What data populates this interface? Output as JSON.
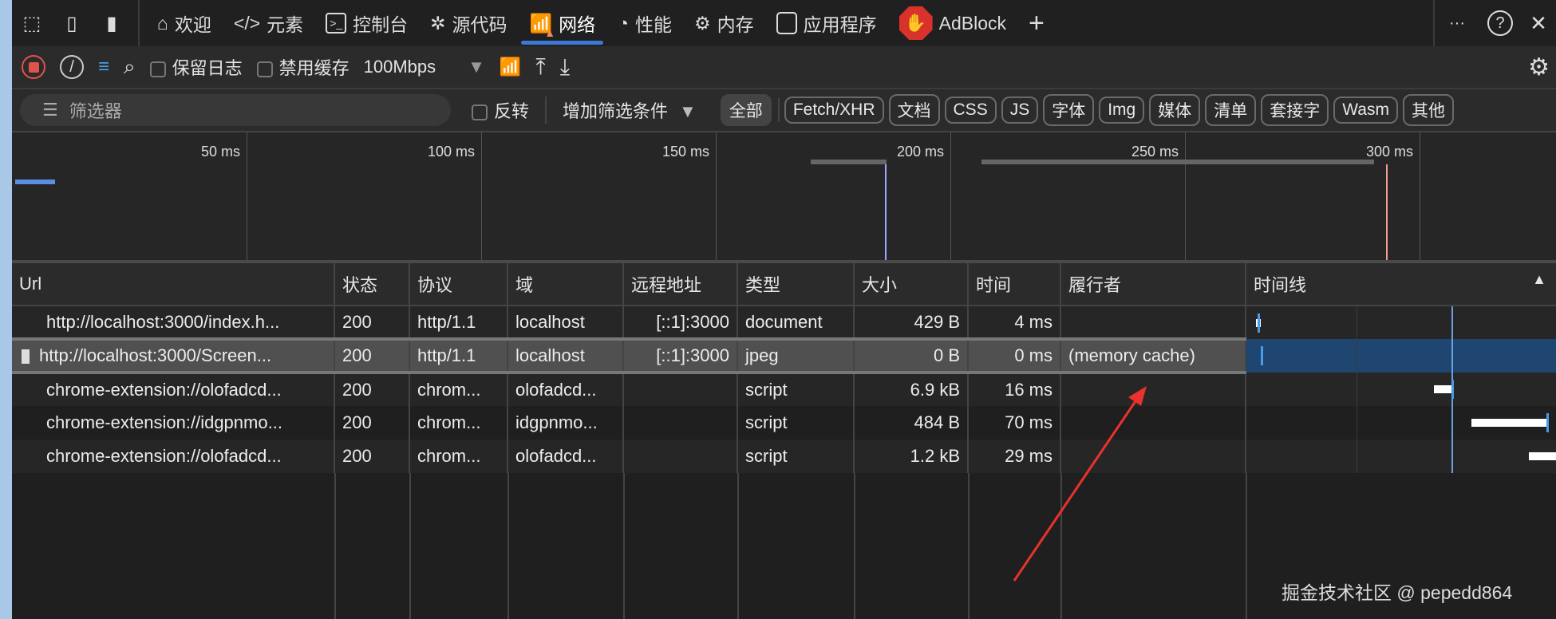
{
  "tabs": {
    "items": [
      {
        "label": "欢迎",
        "icon": "home-icon"
      },
      {
        "label": "元素",
        "icon": "code-icon"
      },
      {
        "label": "控制台",
        "icon": "console-icon"
      },
      {
        "label": "源代码",
        "icon": "bug-icon"
      },
      {
        "label": "网络",
        "icon": "wifi-warning-icon",
        "active": true
      },
      {
        "label": "性能",
        "icon": "gauge-icon"
      },
      {
        "label": "内存",
        "icon": "chip-icon"
      },
      {
        "label": "应用程序",
        "icon": "window-icon"
      },
      {
        "label": "AdBlock",
        "icon": "adblock-hand-icon"
      }
    ],
    "more": "···",
    "help": "?",
    "close": "✕",
    "add": "+"
  },
  "toolbar": {
    "preserve_log": "保留日志",
    "disable_cache": "禁用缓存",
    "throttle": "100Mbps"
  },
  "filter": {
    "placeholder": "筛选器",
    "invert": "反转",
    "add_condition": "增加筛选条件",
    "chips": [
      "全部",
      "Fetch/XHR",
      "文档",
      "CSS",
      "JS",
      "字体",
      "Img",
      "媒体",
      "清单",
      "套接字",
      "Wasm",
      "其他"
    ]
  },
  "overview": {
    "ticks": [
      "50 ms",
      "100 ms",
      "150 ms",
      "200 ms",
      "250 ms",
      "300 ms"
    ]
  },
  "table": {
    "headers": [
      "Url",
      "状态",
      "协议",
      "域",
      "远程地址",
      "类型",
      "大小",
      "时间",
      "履行者",
      "时间线"
    ],
    "rows": [
      {
        "url": "http://localhost:3000/index.h...",
        "status": "200",
        "protocol": "http/1.1",
        "domain": "localhost",
        "remote": "[::1]:3000",
        "type": "document",
        "size": "429 B",
        "time": "4 ms",
        "fulfilled": ""
      },
      {
        "url": "http://localhost:3000/Screen...",
        "status": "200",
        "protocol": "http/1.1",
        "domain": "localhost",
        "remote": "[::1]:3000",
        "type": "jpeg",
        "size": "0 B",
        "time": "0 ms",
        "fulfilled": "(memory cache)",
        "selected": true
      },
      {
        "url": "chrome-extension://olofadcd...",
        "status": "200",
        "protocol": "chrom...",
        "domain": "olofadcd...",
        "remote": "",
        "type": "script",
        "size": "6.9 kB",
        "time": "16 ms",
        "fulfilled": ""
      },
      {
        "url": "chrome-extension://idgpnmo...",
        "status": "200",
        "protocol": "chrom...",
        "domain": "idgpnmo...",
        "remote": "",
        "type": "script",
        "size": "484 B",
        "time": "70 ms",
        "fulfilled": ""
      },
      {
        "url": "chrome-extension://olofadcd...",
        "status": "200",
        "protocol": "chrom...",
        "domain": "olofadcd...",
        "remote": "",
        "type": "script",
        "size": "1.2 kB",
        "time": "29 ms",
        "fulfilled": ""
      }
    ]
  },
  "watermark": "掘金技术社区 @ pepedd864",
  "colors": {
    "accent": "#3b78d8",
    "annotation_arrow": "#e8322d",
    "adblock": "#d9312b",
    "record": "#e0534a"
  }
}
